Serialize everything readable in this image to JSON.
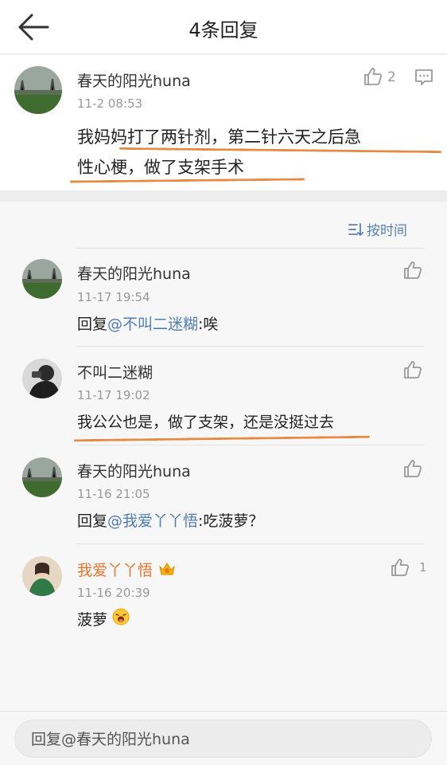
{
  "header": {
    "title": "4条回复"
  },
  "main_comment": {
    "author": "春天的阳光huna",
    "time": "11-2 08:53",
    "like_count": "2",
    "content_line1": "我妈妈打了两针剂，第二针六天之后急",
    "content_line2": "性心梗，做了支架手术"
  },
  "sort": {
    "label": "按时间"
  },
  "replies": [
    {
      "author": "春天的阳光huna",
      "time": "11-17 19:54",
      "prefix": "回复",
      "mention": "@不叫二迷糊",
      "text": ":唉"
    },
    {
      "author": "不叫二迷糊",
      "time": "11-17 19:02",
      "text": "我公公也是，做了支架，还是没挺过去"
    },
    {
      "author": "春天的阳光huna",
      "time": "11-16 21:05",
      "prefix": "回复",
      "mention": "@我爱丫丫悟",
      "text": ":吃菠萝？"
    },
    {
      "author": "我爱丫丫悟",
      "time": "11-16 20:39",
      "text": "菠萝",
      "like_count": "1"
    }
  ],
  "footer": {
    "placeholder": "回复@春天的阳光huna"
  },
  "colors": {
    "accent_link": "#4f7cb5",
    "underline": "#e98a43",
    "vip_name": "#e7742b"
  }
}
